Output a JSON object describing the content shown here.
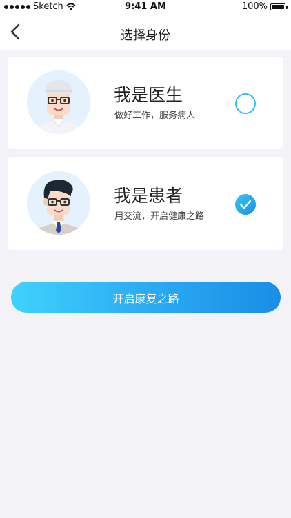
{
  "status_bar": {
    "carrier": "Sketch",
    "time": "9:41 AM",
    "battery": "100%",
    "battery_level": 1.0
  },
  "nav": {
    "title": "选择身份",
    "back_icon": "chevron-left-icon"
  },
  "roles": [
    {
      "title": "我是医生",
      "description": "做好工作，服务病人",
      "selected": false,
      "avatar_icon": "doctor-avatar-icon"
    },
    {
      "title": "我是患者",
      "description": "用交流，开启健康之路",
      "selected": true,
      "avatar_icon": "patient-avatar-icon"
    }
  ],
  "primary_button": {
    "label": "开启康复之路"
  },
  "colors": {
    "accent": "#35bde8",
    "button_gradient_start": "#3fd2fb",
    "button_gradient_end": "#1a8ee6",
    "background": "#f2f2f7"
  }
}
